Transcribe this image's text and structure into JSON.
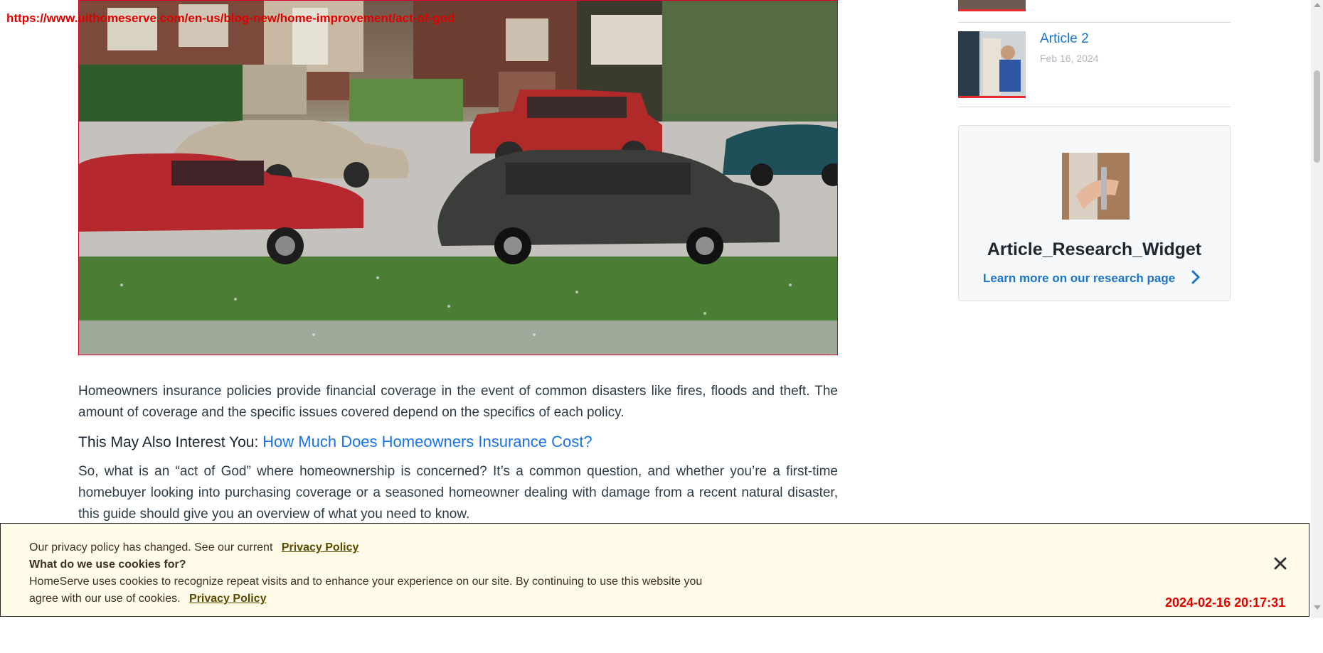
{
  "overlay": {
    "url": "https://www.uithomeserve.com/en-us/blog-new/home-improvement/act-of-god",
    "timestamp": "2024-02-16 20:17:31"
  },
  "article": {
    "paragraph1": "Homeowners insurance policies provide financial coverage in the event of common disasters like fires, floods and theft. The amount of coverage and the specific issues covered depend on the specifics of each policy.",
    "interest_label": "This May Also Interest You:",
    "interest_link": "How Much Does Homeowners Insurance Cost?",
    "paragraph2": "So, what is an “act of God” where homeownership is concerned? It’s a common question, and whether you’re a first-time homebuyer looking into purchasing coverage or a seasoned homeowner dealing with damage from a recent natural disaster, this guide should give you an overview of what you need to know."
  },
  "sidebar": {
    "article2_title": "Article 2",
    "article2_date": "Feb 16, 2024",
    "widget_title": "Article_Research_Widget",
    "widget_link": "Learn more on our research page"
  },
  "cookie": {
    "line1": "Our privacy policy has changed. See our current",
    "privacy_link_1": "Privacy Policy",
    "heading": "What do we use cookies for?",
    "body": "HomeServe uses cookies to recognize repeat visits and to enhance your experience on our site. By continuing to use this website you agree with our use of cookies.",
    "privacy_link_2": "Privacy Policy"
  },
  "icons": {
    "close": "close-icon",
    "chevron": "chevron-right-icon"
  },
  "colors": {
    "link_blue": "#1a73c8",
    "accent_red": "#e32d2d",
    "cookie_bg": "#fffbe8"
  }
}
